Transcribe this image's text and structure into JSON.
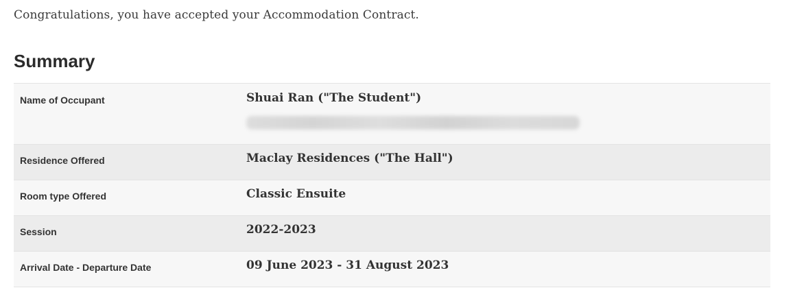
{
  "intro": "Congratulations, you have accepted your Accommodation Contract.",
  "summary": {
    "heading": "Summary",
    "rows": [
      {
        "label": "Name of Occupant",
        "value": "Shuai Ran (\"The Student\")"
      },
      {
        "label": "Residence Offered",
        "value": "Maclay Residences (\"The Hall\")"
      },
      {
        "label": "Room type Offered",
        "value": "Classic Ensuite"
      },
      {
        "label": "Session",
        "value": "2022-2023"
      },
      {
        "label": "Arrival Date - Departure Date",
        "value": "09 June 2023 - 31 August 2023"
      }
    ]
  }
}
